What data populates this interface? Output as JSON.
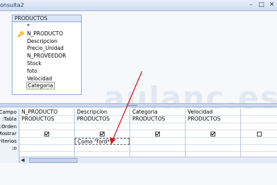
{
  "window": {
    "title": "onsulta2",
    "buttons": {
      "minimize": "–",
      "maximize": "□",
      "close": "✕"
    }
  },
  "table": {
    "name": "PRODUCTOS",
    "fields": [
      "*",
      "N_PRODUCTO",
      "Descripcion",
      "Precio_Unidad",
      "N_PROVEEDOR",
      "Stock",
      "foto",
      "Velocidad",
      "Categoria"
    ],
    "key_icon": "key-icon"
  },
  "watermark": "aulanc.es",
  "grid": {
    "row_labels": [
      "Campo:",
      "Tabla:",
      "Orden:",
      "Mostrar:",
      "Criterios:",
      "o:"
    ],
    "columns": [
      {
        "campo": "N_PRODUCTO",
        "tabla": "PRODUCTOS",
        "mostrar": true,
        "criterios": ""
      },
      {
        "campo": "Descripcion",
        "tabla": "PRODUCTOS",
        "mostrar": true,
        "criterios": "Como \"ford*\""
      },
      {
        "campo": "Categoria",
        "tabla": "PRODUCTOS",
        "mostrar": true,
        "criterios": ""
      },
      {
        "campo": "Velocidad",
        "tabla": "PRODUCTOS",
        "mostrar": true,
        "criterios": ""
      },
      {
        "campo": "",
        "tabla": "",
        "mostrar": false,
        "criterios": ""
      }
    ]
  },
  "colors": {
    "accent": "#e3151a",
    "border": "#8eaad8"
  }
}
